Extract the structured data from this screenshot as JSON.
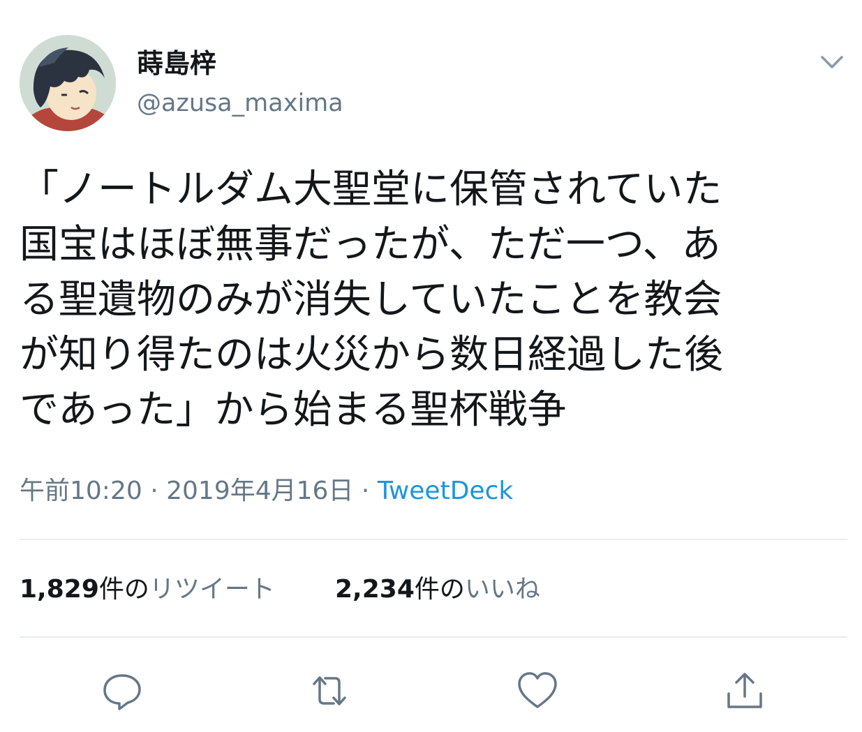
{
  "user": {
    "display_name": "蒔島梓",
    "handle": "@azusa_maxima"
  },
  "tweet": {
    "text": "「ノートルダム大聖堂に保管されていた\n国宝はほぼ無事だったが、ただ一つ、あ\nる聖遺物のみが消失していたことを教会\nが知り得たのは火災から数日経過した後\nであった」から始まる聖杯戦争",
    "time": "午前10:20",
    "separator": "·",
    "date": "2019年4月16日",
    "source": "TweetDeck"
  },
  "stats": {
    "retweets": {
      "count": "1,829",
      "unit": "件の",
      "label": "リツイート"
    },
    "likes": {
      "count": "2,234",
      "unit": "件の",
      "label": "いいね"
    }
  },
  "icons": {
    "menu": "chevron-down-icon",
    "reply": "reply-icon",
    "retweet": "retweet-icon",
    "like": "heart-icon",
    "share": "share-icon"
  },
  "colors": {
    "text": "#14171a",
    "secondary": "#657786",
    "link": "#1b95e0",
    "divider": "#e6ecf0",
    "icon": "#657786"
  }
}
